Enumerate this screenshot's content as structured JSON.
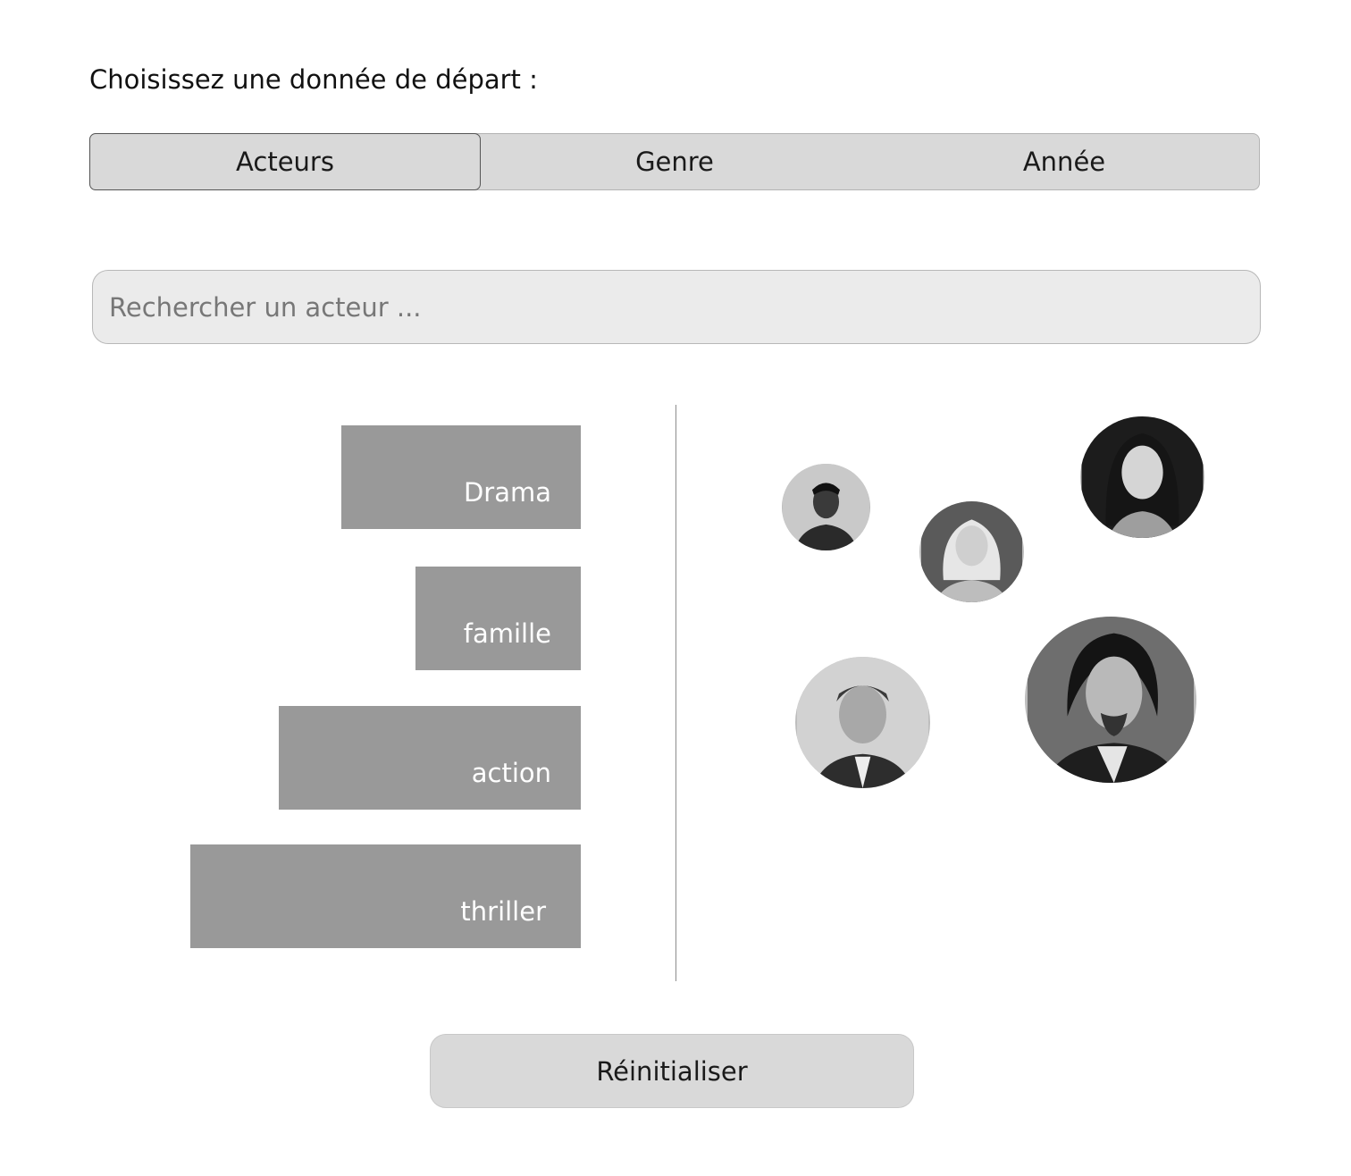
{
  "prompt": "Choisissez une donnée de départ :",
  "tabs": [
    {
      "label": "Acteurs",
      "active": true
    },
    {
      "label": "Genre",
      "active": false
    },
    {
      "label": "Année",
      "active": false
    }
  ],
  "search": {
    "placeholder": "Rechercher un acteur ...",
    "value": ""
  },
  "genres": [
    {
      "label": "Drama"
    },
    {
      "label": "famille"
    },
    {
      "label": "action"
    },
    {
      "label": "thriller"
    }
  ],
  "colors": {
    "bar": "#999999",
    "tab_bg": "#d9d9d9",
    "search_bg": "#ebebeb"
  },
  "reset_label": "Réinitialiser"
}
